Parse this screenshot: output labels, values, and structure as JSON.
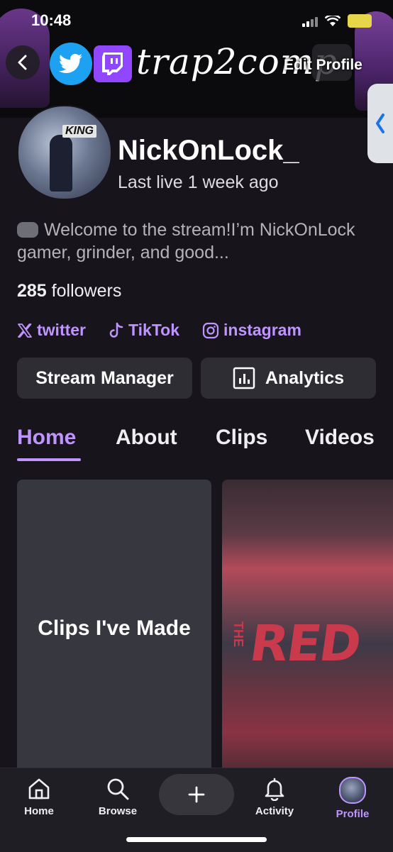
{
  "status": {
    "time": "10:48"
  },
  "banner": {
    "handle": "trap2comp",
    "edit_label": "Edit Profile"
  },
  "profile": {
    "username": "NickOnLock_",
    "last_live": "Last live 1 week ago",
    "avatar_text": "KING",
    "bio": "Welcome to the stream!I’m NickOnLock  gamer, grinder, and good...",
    "followers_count": "285",
    "followers_label": "followers"
  },
  "socials": [
    {
      "label": "twitter",
      "icon": "x-icon"
    },
    {
      "label": "TikTok",
      "icon": "tiktok-icon"
    },
    {
      "label": "instagram",
      "icon": "instagram-icon"
    }
  ],
  "actions": {
    "stream_manager": "Stream Manager",
    "analytics": "Analytics"
  },
  "tabs": [
    {
      "label": "Home",
      "active": true
    },
    {
      "label": "About"
    },
    {
      "label": "Clips"
    },
    {
      "label": "Videos"
    }
  ],
  "content": {
    "clips_card": "Clips I've Made",
    "video_thumb_text": "RED",
    "video_thumb_small": "THE"
  },
  "nav": [
    {
      "label": "Home",
      "icon": "home-icon"
    },
    {
      "label": "Browse",
      "icon": "search-icon"
    },
    {
      "label": "Activity",
      "icon": "bell-icon"
    },
    {
      "label": "Profile",
      "icon": "avatar",
      "active": true
    }
  ],
  "colors": {
    "accent": "#bf94ff",
    "background": "#17151b",
    "button": "#2e2d33",
    "twitch": "#9146ff",
    "twitter": "#1da1f2"
  }
}
